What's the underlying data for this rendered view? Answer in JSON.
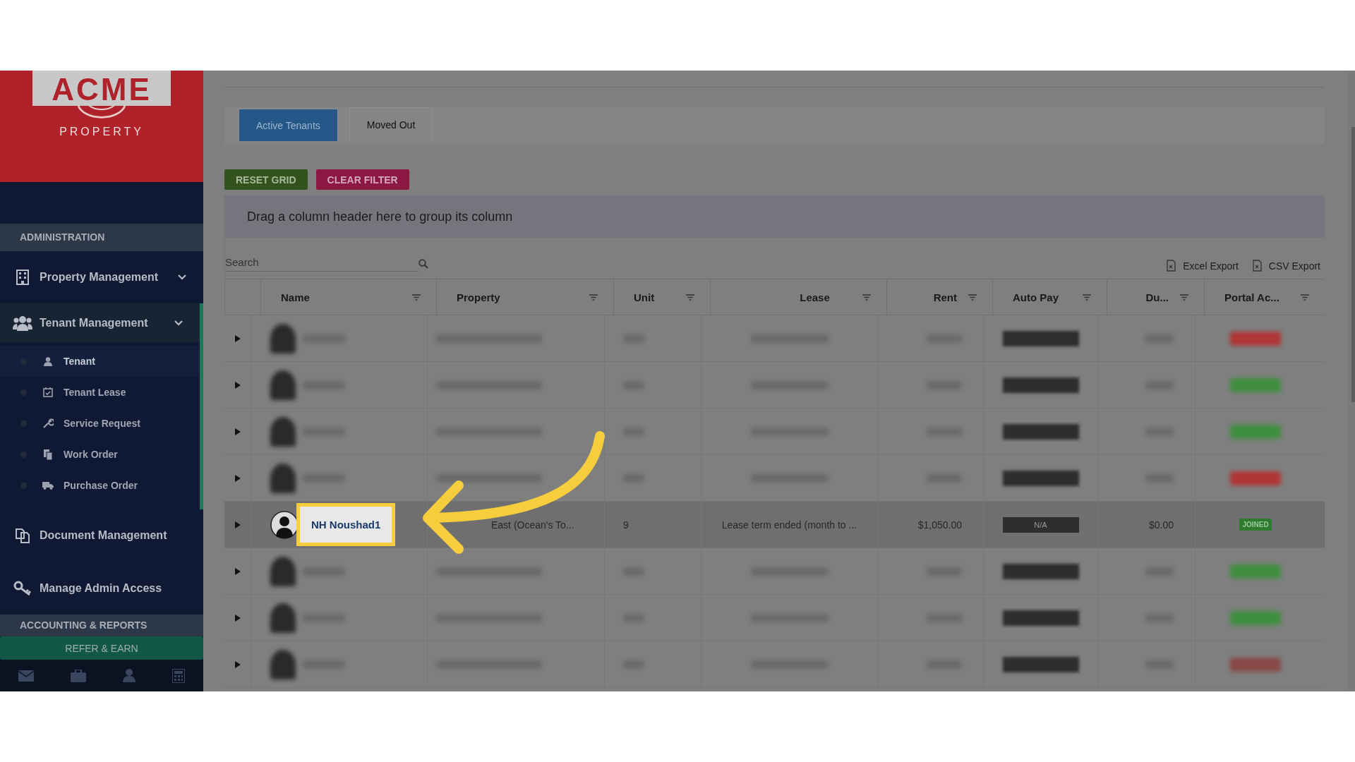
{
  "sidebar": {
    "logo": {
      "title": "ACME",
      "subtitle": "PROPERTY"
    },
    "admin_header": "ADMINISTRATION",
    "menu": [
      {
        "label": "Property Management",
        "kind": "group",
        "expanded": false
      },
      {
        "label": "Tenant Management",
        "kind": "group",
        "expanded": true,
        "children": [
          {
            "label": "Tenant",
            "selected": true
          },
          {
            "label": "Tenant Lease",
            "selected": false
          },
          {
            "label": "Service Request",
            "selected": false
          },
          {
            "label": "Work Order",
            "selected": false
          },
          {
            "label": "Purchase Order",
            "selected": false
          }
        ]
      },
      {
        "label": "Document Management",
        "kind": "link",
        "expanded": false
      },
      {
        "label": "Manage Admin Access",
        "kind": "link",
        "expanded": false
      }
    ],
    "accounting_header": "ACCOUNTING & REPORTS",
    "refer_button": "REFER & EARN"
  },
  "tabs": [
    {
      "label": "Active Tenants",
      "selected": true
    },
    {
      "label": "Moved Out",
      "selected": false
    }
  ],
  "toolbar": {
    "reset_button": "RESET GRID",
    "clear_button": "CLEAR FILTER"
  },
  "group_panel": "Drag a column header here to group its column",
  "search": {
    "placeholder": "Search"
  },
  "exports": [
    "Excel Export",
    "CSV Export"
  ],
  "table": {
    "columns": [
      "Name",
      "Property",
      "Unit",
      "Lease",
      "Rent",
      "Auto Pay",
      "Du...",
      "Portal Ac..."
    ],
    "rows": [
      {
        "kind": "blurred",
        "color": "#b03535"
      },
      {
        "kind": "blurred",
        "color": "#3f8f3f"
      },
      {
        "kind": "blurred",
        "color": "#3f8f3f"
      },
      {
        "kind": "blurred",
        "color": "#b03535"
      },
      {
        "kind": "data",
        "highlighted": true,
        "name": "NH Noushad1",
        "property": "East (Ocean's To...",
        "unit": "9",
        "lease": "Lease term ended (month to ...",
        "rent": "$1,050.00",
        "auto_pay": "N/A",
        "due": "$0.00",
        "portal": "JOINED"
      },
      {
        "kind": "blurred",
        "color": "#3f8f3f"
      },
      {
        "kind": "blurred",
        "color": "#3f8f3f"
      },
      {
        "kind": "blurred",
        "color": "#8a4848"
      }
    ]
  }
}
